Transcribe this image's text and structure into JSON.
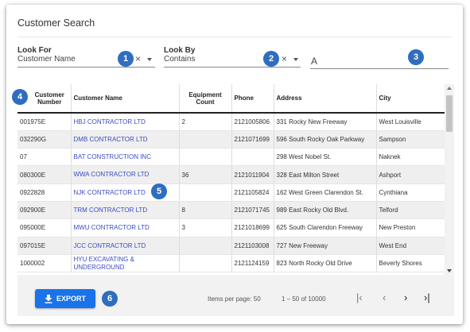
{
  "title": "Customer Search",
  "filters": {
    "look_for": {
      "label": "Look For",
      "value": "Customer Name"
    },
    "look_by": {
      "label": "Look By",
      "value": "Contains"
    },
    "search": {
      "value": "A"
    }
  },
  "badges": [
    "1",
    "2",
    "3",
    "4",
    "5",
    "6"
  ],
  "table": {
    "columns": [
      "Customer Number",
      "Customer Name",
      "Equipment Count",
      "Phone",
      "Address",
      "City"
    ],
    "rows": [
      {
        "number": "001975E",
        "name": "HBJ CONTRACTOR LTD",
        "equipment": "2",
        "phone": "2121005806",
        "address": "331 Rocky New Freeway",
        "city": "West Louisville"
      },
      {
        "number": "032290G",
        "name": "DMB CONTRACTOR LTD",
        "equipment": "",
        "phone": "2121071699",
        "address": "596 South Rocky Oak Parkway",
        "city": "Sampson"
      },
      {
        "number": "07",
        "name": "BAT CONSTRUCTION INC",
        "equipment": "",
        "phone": "",
        "address": "298 West Nobel St.",
        "city": "Naknek"
      },
      {
        "number": "080300E",
        "name": "WWA CONTRACTOR LTD",
        "equipment": "36",
        "phone": "2121011904",
        "address": "328 East Milton Street",
        "city": "Ashport"
      },
      {
        "number": "0922828",
        "name": "NJK CONTRACTOR LTD",
        "equipment": "",
        "phone": "2121105824",
        "address": "162 West Green Clarendon St.",
        "city": "Cynthiana"
      },
      {
        "number": "092900E",
        "name": "TRM CONTRACTOR LTD",
        "equipment": "8",
        "phone": "2121071745",
        "address": "989 East Rocky Old Blvd.",
        "city": "Telford"
      },
      {
        "number": "095000E",
        "name": "MWU CONTRACTOR LTD",
        "equipment": "3",
        "phone": "2121018699",
        "address": "625 South Clarendon Freeway",
        "city": "New Preston"
      },
      {
        "number": "097015E",
        "name": "JCC CONTRACTOR LTD",
        "equipment": "",
        "phone": "2121103008",
        "address": "727 New Freeway",
        "city": "West End"
      },
      {
        "number": "1000002",
        "name": "HYU EXCAVATING & UNDERGROUND",
        "equipment": "",
        "phone": "2121124159",
        "address": "823 North Rocky Old Drive",
        "city": "Beverly Shores"
      }
    ]
  },
  "footer": {
    "export_label": "EXPORT",
    "items_per_page_label": "Items per page: 50",
    "range_label": "1 – 50 of 10000"
  },
  "colors": {
    "accent": "#1a73e8",
    "badge": "#2f6dbf",
    "link": "#3a4cc4"
  }
}
